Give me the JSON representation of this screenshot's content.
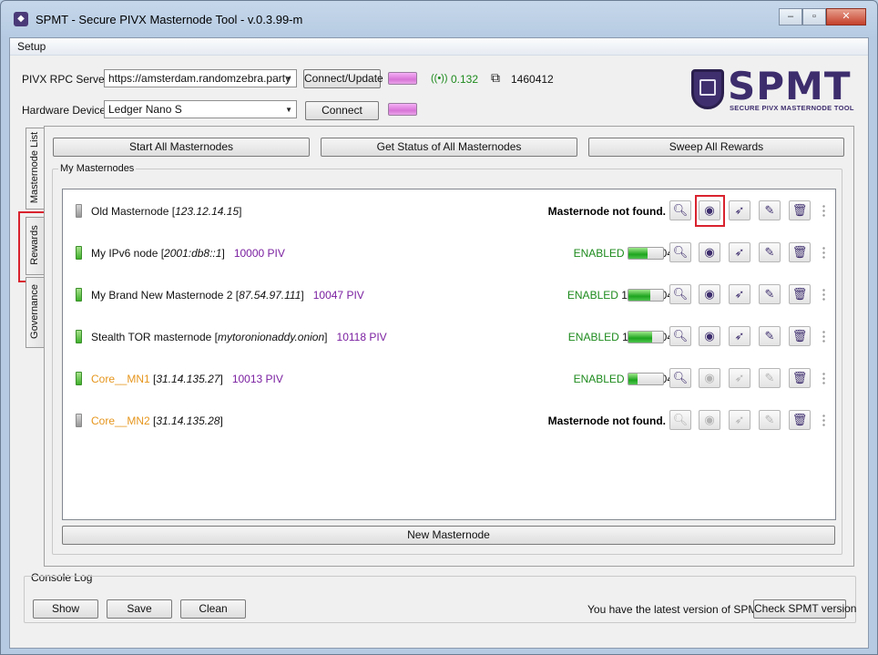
{
  "window": {
    "title": "SPMT - Secure PIVX Masternode Tool - v.0.3.99-m",
    "min_glyph": "–",
    "max_glyph": "▫",
    "close_glyph": "✕"
  },
  "menu": {
    "setup": "Setup"
  },
  "connection": {
    "rpc_label": "PIVX RPC Server",
    "rpc_value": "https://amsterdam.randomzebra.party",
    "connect_update": "Connect/Update",
    "response_time": "0.132",
    "block_height": "1460412",
    "hw_label": "Hardware Device",
    "hw_value": "Ledger Nano S",
    "connect": "Connect"
  },
  "logo": {
    "text": "SPMT",
    "subtitle": "SECURE PIVX MASTERNODE TOOL"
  },
  "tabs": {
    "masternode_list": "Masternode List",
    "rewards": "Rewards",
    "governance": "Governance"
  },
  "actions": {
    "start_all": "Start All Masternodes",
    "get_status": "Get Status of All Masternodes",
    "sweep": "Sweep All Rewards",
    "new_mn": "New Masternode"
  },
  "group_title": "My Masternodes",
  "icons": [
    "search-icon",
    "eye-icon",
    "rocket-icon",
    "edit-icon",
    "trash-icon"
  ],
  "masternodes": [
    {
      "name": "Old Masternode",
      "ip": "123.12.14.15",
      "balance": "",
      "status": "Masternode not found.",
      "count": "",
      "progress": 0,
      "led": "gray",
      "name_color": "#111111",
      "enabled": true
    },
    {
      "name": "My IPv6 node",
      "ip": "2001:db8::1",
      "balance": "10000 PIV",
      "status": "ENABLED",
      "count": "891/1604",
      "progress": 0.555,
      "led": "green",
      "name_color": "#111111",
      "enabled": true
    },
    {
      "name": "My Brand New Masternode 2",
      "ip": "87.54.97.111",
      "balance": "10047 PIV",
      "status": "ENABLED",
      "count": "1019/1604",
      "progress": 0.635,
      "led": "green",
      "name_color": "#111111",
      "enabled": true
    },
    {
      "name": "Stealth TOR masternode",
      "ip": "mytoronionaddy.onion",
      "balance": "10118 PIV",
      "status": "ENABLED",
      "count": "1104/1604",
      "progress": 0.688,
      "led": "green",
      "name_color": "#111111",
      "enabled": true
    },
    {
      "name": "Core__MN1",
      "ip": "31.14.135.27",
      "balance": "10013 PIV",
      "status": "ENABLED",
      "count": "410/1604",
      "progress": 0.255,
      "led": "green",
      "name_color": "#e6961d",
      "enabled": false
    },
    {
      "name": "Core__MN2",
      "ip": "31.14.135.28",
      "balance": "",
      "status": "Masternode not found.",
      "count": "",
      "progress": 0,
      "led": "gray",
      "name_color": "#e6961d",
      "enabled": false
    }
  ],
  "console": {
    "title": "Console Log",
    "show": "Show",
    "save": "Save",
    "clean": "Clean",
    "version_msg": "You have the latest version of SPMT",
    "check_version": "Check SPMT version"
  },
  "colors": {
    "enabled_green": "#1d8a1d",
    "balance_purple": "#7a1fa0",
    "highlight_red": "#d9232e",
    "brand_purple": "#3d2d6d"
  }
}
